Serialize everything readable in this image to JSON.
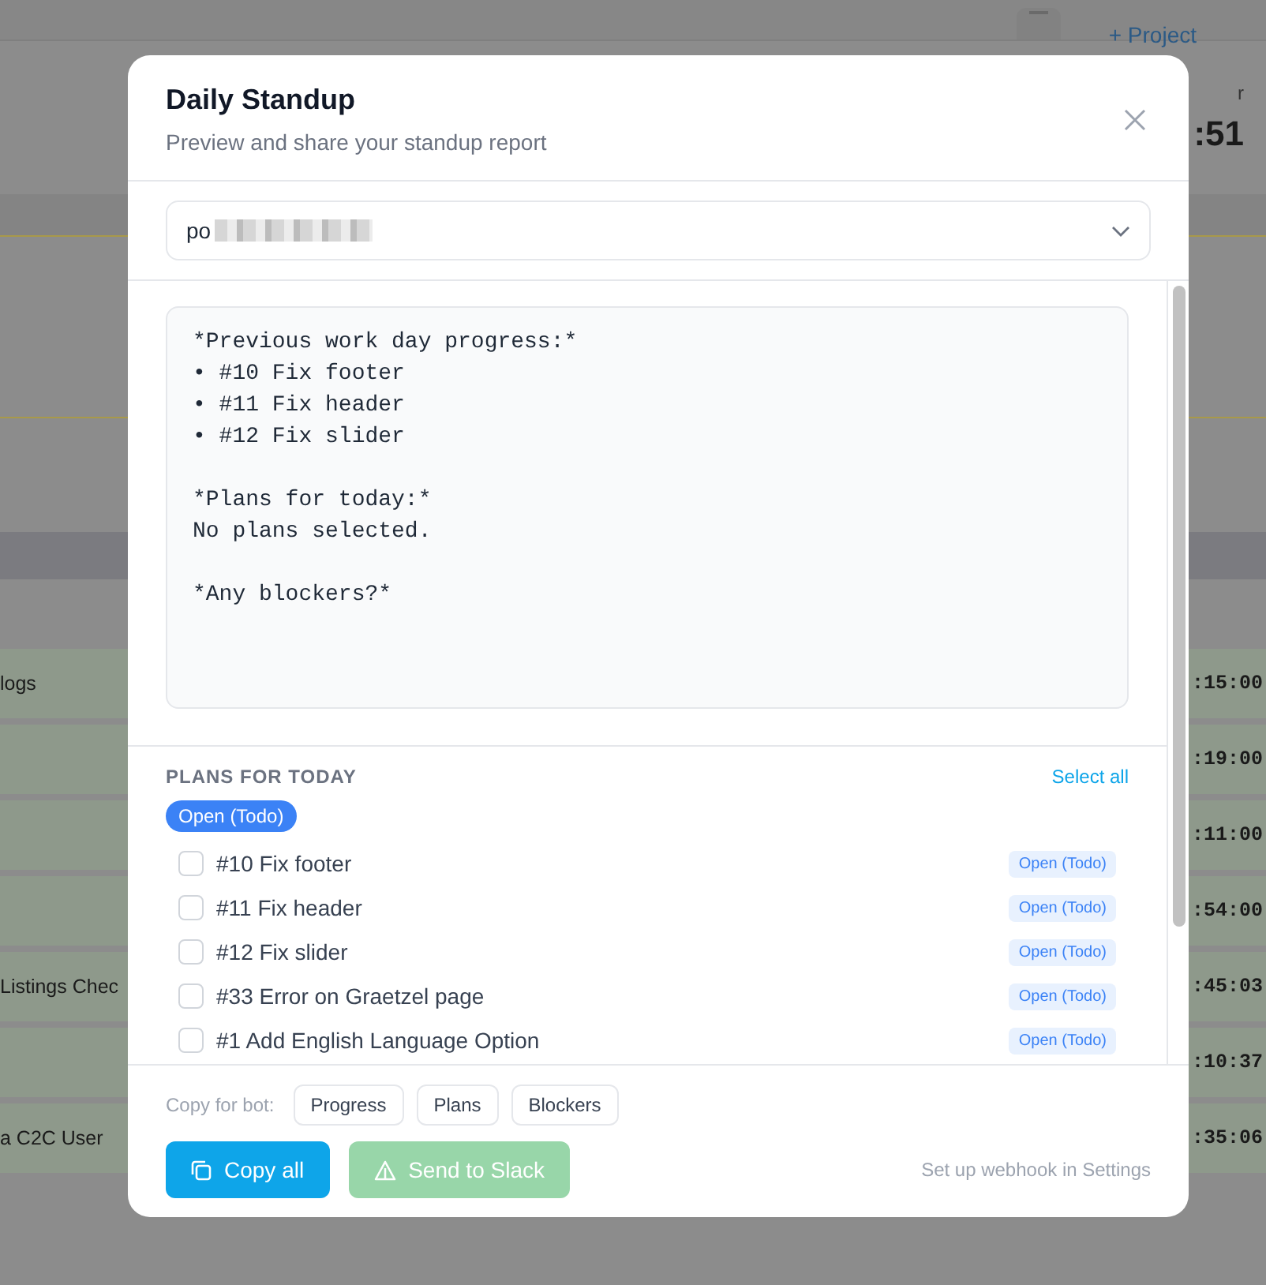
{
  "background": {
    "top_link": "+ Project",
    "header_label": "r",
    "header_value": ":51",
    "rows": [
      {
        "title": "logs",
        "time": ":15:00"
      },
      {
        "time": ":19:00"
      },
      {
        "time": ":11:00"
      },
      {
        "time": ":54:00"
      },
      {
        "title": "Listings Chec",
        "time": ":45:03"
      },
      {
        "time": ":10:37"
      },
      {
        "title": "a C2C User",
        "time": ":35:06"
      }
    ]
  },
  "modal": {
    "title": "Daily Standup",
    "subtitle": "Preview and share your standup report",
    "project_select": {
      "value": "po"
    },
    "report_text": "*Previous work day progress:*\n• #10 Fix footer\n• #11 Fix header\n• #12 Fix slider\n\n*Plans for today:*\nNo plans selected.\n\n*Any blockers?*",
    "plans": {
      "heading": "PLANS FOR TODAY",
      "select_all": "Select all",
      "filters": [
        {
          "label": "Open (Todo)",
          "selected": true
        }
      ],
      "items": [
        {
          "label": "#10 Fix footer",
          "status": "Open (Todo)",
          "checked": false
        },
        {
          "label": "#11 Fix header",
          "status": "Open (Todo)",
          "checked": false
        },
        {
          "label": "#12 Fix slider",
          "status": "Open (Todo)",
          "checked": false
        },
        {
          "label": "#33 Error on Graetzel page",
          "status": "Open (Todo)",
          "checked": false
        },
        {
          "label": "#1 Add English Language Option",
          "status": "Open (Todo)",
          "checked": false
        }
      ]
    },
    "footer": {
      "copy_label": "Copy for bot:",
      "copy_buttons": [
        "Progress",
        "Plans",
        "Blockers"
      ],
      "copy_all": "Copy all",
      "send": {
        "label": "Send to Slack",
        "disabled": true
      },
      "hint": "Set up webhook in Settings"
    }
  }
}
